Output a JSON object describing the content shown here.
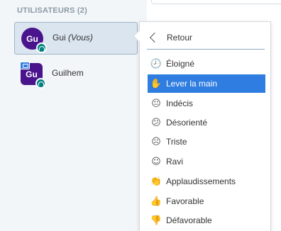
{
  "users_panel": {
    "title": "UTILISATEURS (2)",
    "users": [
      {
        "initials": "Gu",
        "name": "Gui",
        "suffix": "(Vous)"
      },
      {
        "initials": "Gu",
        "name": "Guilhem"
      }
    ]
  },
  "status_menu": {
    "back_label": "Retour",
    "items": [
      {
        "label": "Éloigné",
        "icon": "clock-icon"
      },
      {
        "label": "Lever la main",
        "icon": "hand-icon"
      },
      {
        "label": "Indécis",
        "icon": "neutral-face-icon"
      },
      {
        "label": "Désorienté",
        "icon": "confused-face-icon"
      },
      {
        "label": "Triste",
        "icon": "sad-face-icon"
      },
      {
        "label": "Ravi",
        "icon": "happy-face-icon"
      },
      {
        "label": "Applaudissements",
        "icon": "applause-icon"
      },
      {
        "label": "Favorable",
        "icon": "thumbs-up-icon"
      },
      {
        "label": "Défavorable",
        "icon": "thumbs-down-icon"
      }
    ],
    "active_item": "Lever la main"
  },
  "colors": {
    "avatar": "#4a148c",
    "audio_badge": "#008081",
    "active_item": "#2f7de1",
    "panel_bg": "#f3f6f9"
  }
}
